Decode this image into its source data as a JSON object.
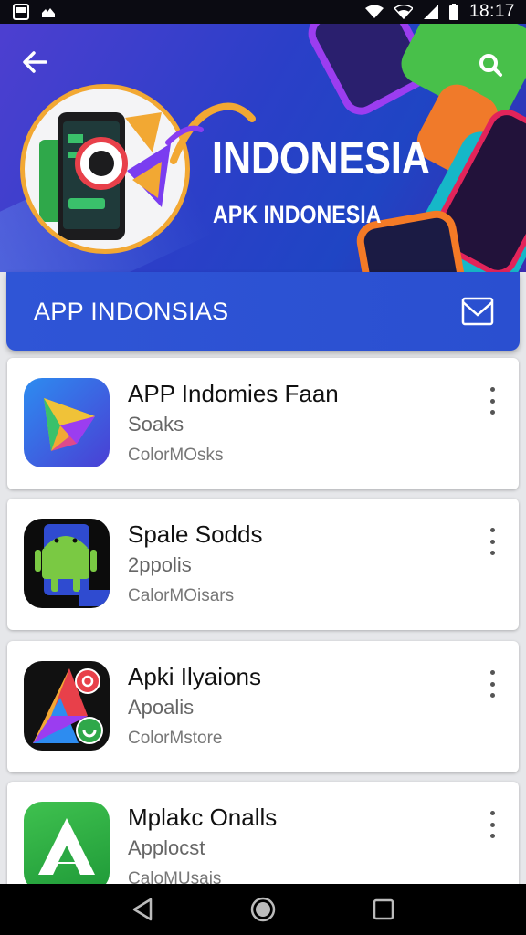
{
  "status_bar": {
    "time": "18:17",
    "icons_left": [
      "gallery-icon",
      "cloud-icon"
    ],
    "icons_right": [
      "wifi-icon",
      "wifi-signal-icon",
      "cell-signal-icon",
      "battery-icon"
    ]
  },
  "hero": {
    "title": "INDONESIA",
    "subtitle": "APK INDONESIA"
  },
  "section": {
    "title": "APP INDONSIAS"
  },
  "apps": [
    {
      "name": "APP Indomies Faan",
      "subtitle": "Soaks",
      "meta": "ColorMOsks"
    },
    {
      "name": "Spale Sodds",
      "subtitle": "2ppolis",
      "meta": "CalorMOisars"
    },
    {
      "name": "Apki Ilyaions",
      "subtitle": "Apoalis",
      "meta": "ColorMstore"
    },
    {
      "name": "Mplakc Onalls",
      "subtitle": "Applocst",
      "meta": "CaloMUsais"
    }
  ],
  "colors": {
    "hero_blue": "#2b3fc8",
    "section_blue": "#2f55d6",
    "accent_orange": "#f2a833"
  }
}
